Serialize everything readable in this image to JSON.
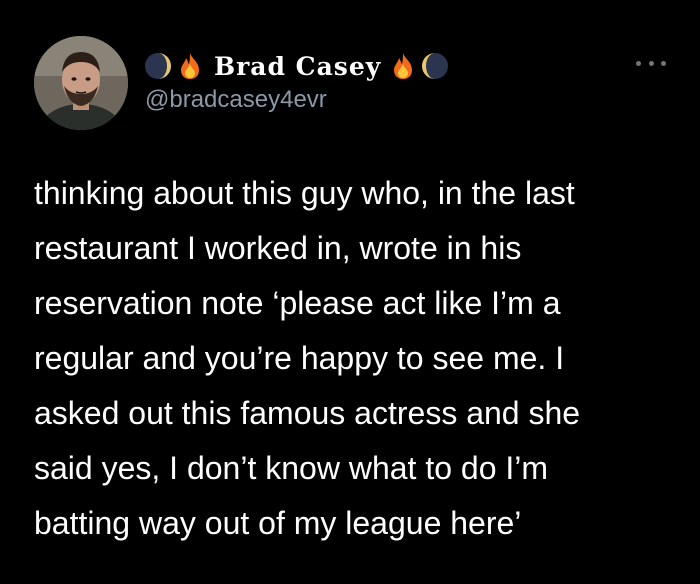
{
  "user": {
    "display_name": "Brad Casey",
    "handle": "@bradcasey4evr",
    "name_emoji_left": [
      "moon-icon",
      "fire-icon"
    ],
    "name_emoji_right": [
      "fire-icon",
      "moon-icon"
    ]
  },
  "menu": {
    "icon": "more-options-icon"
  },
  "tweet": {
    "lines": [
      "thinking about this guy who, in the last",
      "restaurant I worked in, wrote in his",
      "reservation note ‘please act like I’m a",
      "regular and you’re happy to see me. I",
      "asked out this famous actress and she",
      "said yes, I don’t know what to do I’m",
      "batting way out of my league here’"
    ]
  },
  "colors": {
    "background": "#000000",
    "text": "#ffffff",
    "handle": "#8b98a5",
    "more_icon": "#71767b"
  }
}
